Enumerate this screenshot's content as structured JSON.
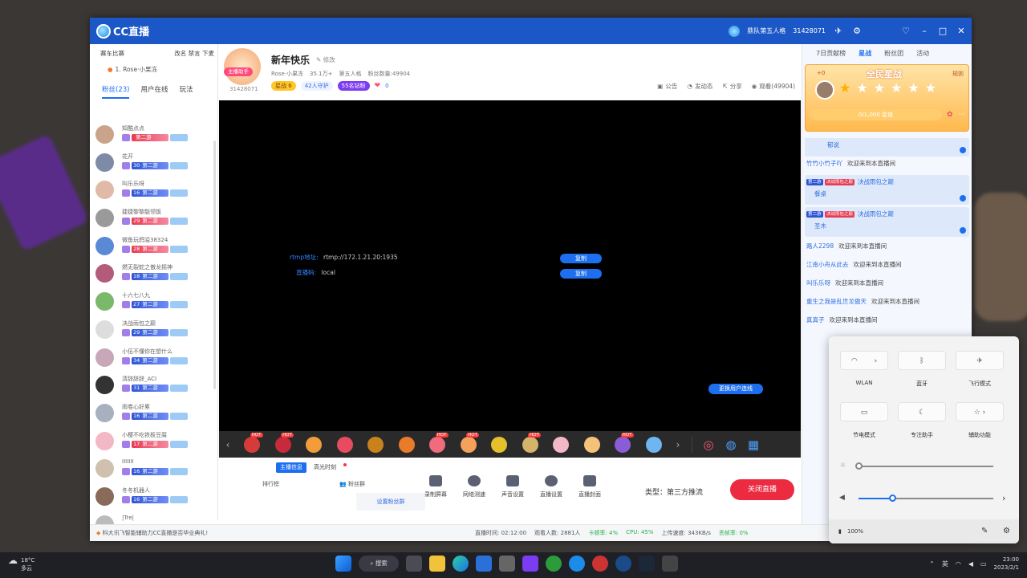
{
  "titlebar": {
    "logo": "CC直播",
    "game": "鼎队第五人格",
    "room_id": "31428071",
    "controls": [
      "minimize-icon",
      "maximize-icon",
      "close-icon"
    ]
  },
  "left_panel": {
    "top_left": "赛车比赛",
    "top_right": "改名 禁言 下麦",
    "rank_line": "1. Rose·小果冻",
    "tabs": [
      {
        "label": "粉丝(23)",
        "active": true
      },
      {
        "label": "用户在线",
        "active": false
      },
      {
        "label": "玩法",
        "active": false
      }
    ],
    "fans": [
      {
        "name": "知酷点点",
        "level": "",
        "badge": "第二游",
        "red": true
      },
      {
        "name": "花开",
        "level": "30",
        "badge": "第二游",
        "red": false
      },
      {
        "name": "叫乐乐呀",
        "level": "16",
        "badge": "第二游",
        "red": false
      },
      {
        "name": "捷捷黎黎能领饭",
        "level": "29",
        "badge": "第二游",
        "red": true
      },
      {
        "name": "微鱼玩鸽溢38324",
        "level": "28",
        "badge": "第二游",
        "red": true
      },
      {
        "name": "燃无裂蛇之傲龙摇神",
        "level": "18",
        "badge": "第二游",
        "red": false
      },
      {
        "name": "十六七八九",
        "level": "27",
        "badge": "第二游",
        "red": false
      },
      {
        "name": "决战雨包之巅",
        "level": "29",
        "badge": "第二游",
        "red": false
      },
      {
        "name": "小伍不懂你在想什么",
        "level": "34",
        "badge": "第二游",
        "red": false
      },
      {
        "name": "清辞辞辞_ACI",
        "level": "31",
        "badge": "第二游",
        "red": false
      },
      {
        "name": "雨卷心好累",
        "level": "16",
        "badge": "第二游",
        "red": false
      },
      {
        "name": "小樱不吃铁板豆腐",
        "level": "17",
        "badge": "第二游",
        "red": true
      },
      {
        "name": "IIIIIII",
        "level": "16",
        "badge": "第二游",
        "red": false
      },
      {
        "name": "冬冬机器人",
        "level": "16",
        "badge": "第二游",
        "red": false
      },
      {
        "name": "|Tre|",
        "level": "",
        "badge": "",
        "red": false
      }
    ]
  },
  "header": {
    "anchor_badge": "主播助手",
    "anchor_id": "31428071",
    "title": "新年快乐",
    "edit": "修改",
    "meta": [
      "Rose·小果冻",
      "35.1万+",
      "第五人格",
      "粉丝数量:49904"
    ],
    "star_level": "星战 6",
    "online": "42人守护",
    "diamond": "55名钻粉",
    "likes": "0",
    "actions": [
      "公告",
      "发动态",
      "分享",
      "观看(49904)"
    ]
  },
  "video": {
    "rtmp_label": "rtmp地址:",
    "rtmp_value": "rtmp://172.1.21.20:1935",
    "key_label": "直播码:",
    "key_value": "local",
    "copy_label": "复制",
    "copy_label2": "复制",
    "line_button": "更换用户连线"
  },
  "gifts": [
    {
      "color": "#d63b3b",
      "hot": true
    },
    {
      "color": "#c72a3a",
      "hot": true
    },
    {
      "color": "#f29c3a",
      "hot": false
    },
    {
      "color": "#e84a5f",
      "hot": false
    },
    {
      "color": "#c9821b",
      "hot": false
    },
    {
      "color": "#e87c2a",
      "hot": false
    },
    {
      "color": "#f06b7c",
      "hot": true
    },
    {
      "color": "#f3a15b",
      "hot": true
    },
    {
      "color": "#e6c02a",
      "hot": false
    },
    {
      "color": "#d6b36a",
      "hot": true
    },
    {
      "color": "#f2b8c6",
      "hot": false
    },
    {
      "color": "#f5c27a",
      "hot": false
    },
    {
      "color": "#8a5cd6",
      "hot": true
    },
    {
      "color": "#6fb6f0",
      "hot": false
    }
  ],
  "controls": {
    "tab_anchor": "主播信息",
    "tab_highlight": "高光时刻",
    "rank": "排行榜",
    "fan_group": "粉丝群",
    "set_fan": "设置粉丝群",
    "tools": [
      "录制屏幕",
      "网络测速",
      "声音设置",
      "直播设置",
      "直播封面"
    ],
    "type": "类型：第三方推流",
    "close_live": "关闭直播"
  },
  "status": {
    "notice": "科大讯飞智能辅助力CC直播是否毕业典礼!",
    "live_time": "直播时间: 02:12:00",
    "viewers": "观看人数: 2881人",
    "lag": "卡顿率: 4%",
    "cpu": "CPU: 45%",
    "upload": "上传速度: 343KB/s",
    "drop": "丢帧率: 0%"
  },
  "right_panel": {
    "tabs": [
      {
        "label": "7日贡献榜",
        "active": false
      },
      {
        "label": "星战",
        "active": true
      },
      {
        "label": "粉丝团",
        "active": false
      },
      {
        "label": "活动",
        "active": false
      }
    ],
    "star_card": {
      "title": "全民星战",
      "plus": "+0",
      "rule": "规则",
      "progress": "0/1,000 星值",
      "stars_total": 6,
      "stars_filled": 1
    },
    "chat": [
      {
        "type": "first",
        "user": "郁说",
        "text": ""
      },
      {
        "type": "plain",
        "user": "竹竹小竹子吖",
        "text": "欢迎来到本直播间"
      },
      {
        "type": "card",
        "user": "餐桌",
        "text": "决战雨包之巅"
      },
      {
        "type": "card",
        "user": "圣木",
        "text": "决战雨包之巅"
      },
      {
        "type": "plain",
        "user": "路人2298",
        "text": "欢迎来到本直播间"
      },
      {
        "type": "plain",
        "user": "江南小舟从此去",
        "text": "欢迎来到本直播间"
      },
      {
        "type": "plain",
        "user": "叫乐乐呀",
        "text": "欢迎来到本直播间"
      },
      {
        "type": "plain",
        "user": "重生之我是乱世龙傲天",
        "text": "欢迎来到本直播间"
      },
      {
        "type": "plain",
        "user": "真真子",
        "text": "欢迎来到本直播间"
      }
    ]
  },
  "quick_settings": {
    "wlan": "WLAN",
    "bluetooth": "蓝牙",
    "airplane": "飞行模式",
    "battery_saver": "节电模式",
    "focus": "专注助手",
    "accessibility": "辅助功能",
    "brightness": 0.0,
    "volume": 0.25,
    "battery": "100%"
  },
  "taskbar": {
    "temp": "18°C",
    "weather": "多云",
    "search": "搜索",
    "lang": "英",
    "time": "23:00",
    "date": "2023/2/1"
  }
}
